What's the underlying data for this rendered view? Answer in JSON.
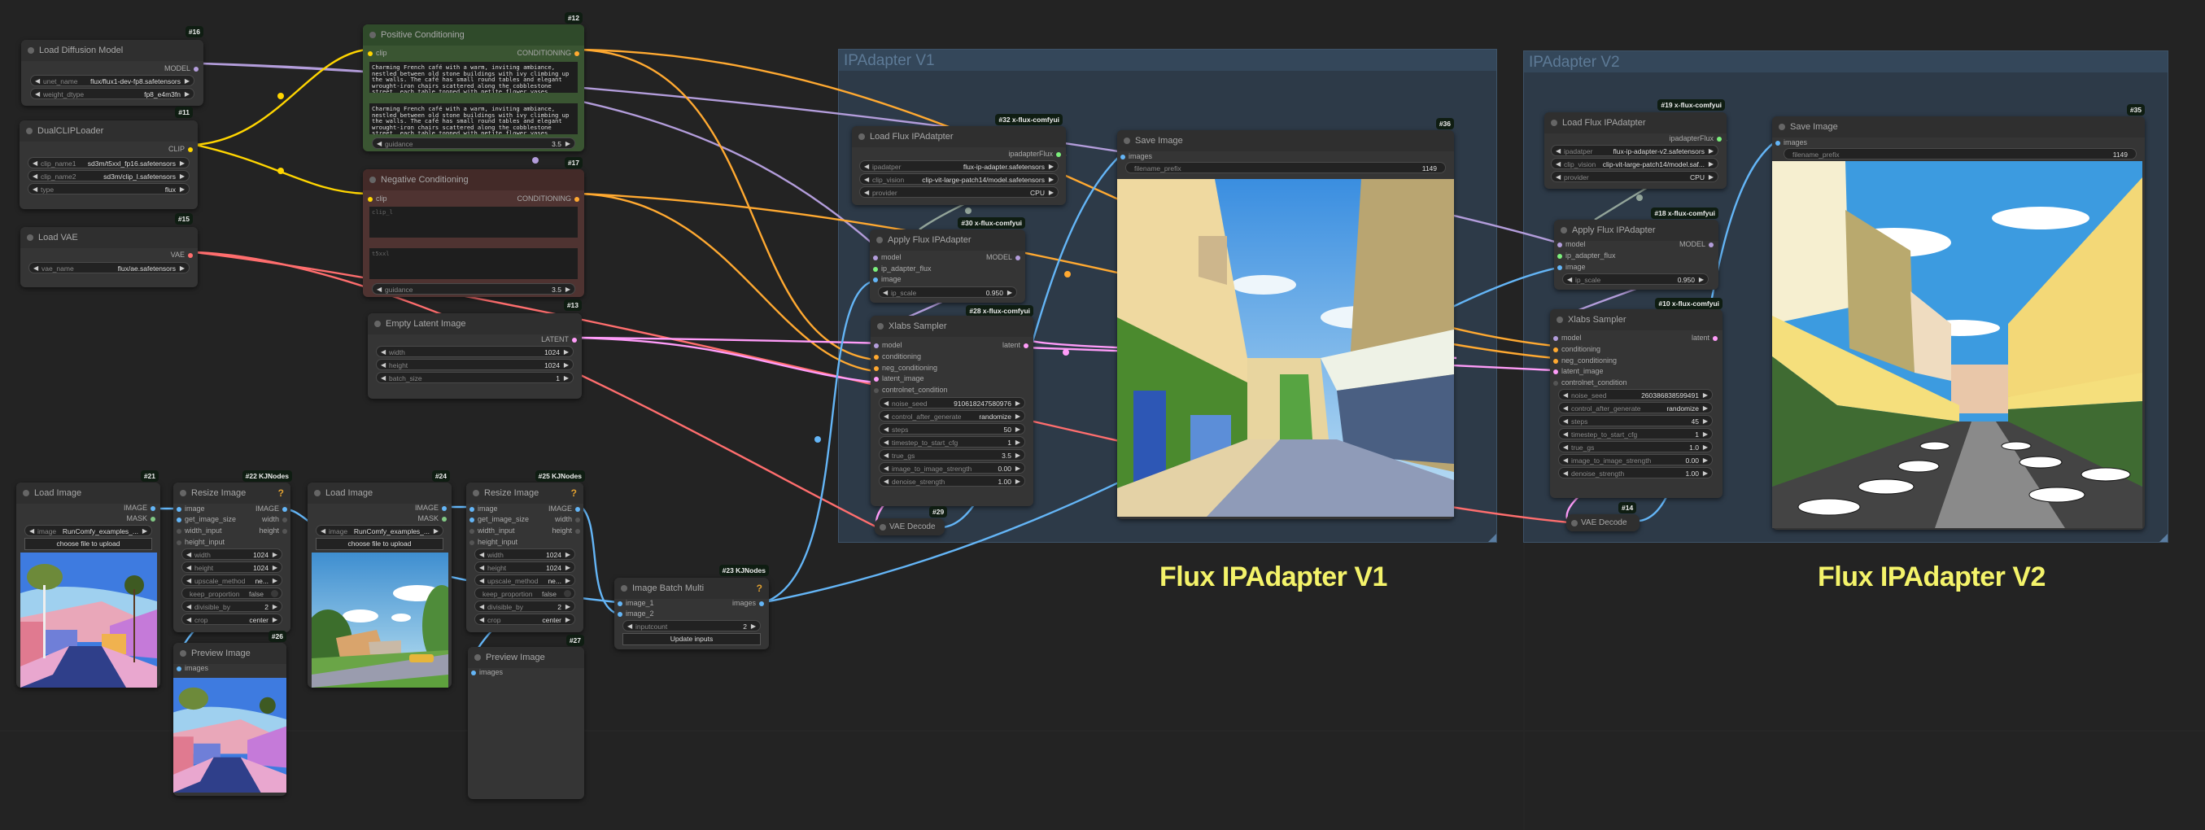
{
  "canvas": {
    "groups": [
      {
        "title": "IPAdapter V1"
      },
      {
        "title": "IPAdapter V2"
      }
    ],
    "labels": [
      "Flux IPAdapter V1",
      "Flux IPAdapter V2"
    ]
  },
  "nodes": {
    "n16": {
      "badge": "#16",
      "title": "Load Diffusion Model",
      "outputs": [
        "MODEL"
      ],
      "widgets": [
        {
          "label": "unet_name",
          "value": "flux/flux1-dev-fp8.safetensors"
        },
        {
          "label": "weight_dtype",
          "value": "fp8_e4m3fn"
        }
      ]
    },
    "n11": {
      "badge": "#11",
      "title": "DualCLIPLoader",
      "outputs": [
        "CLIP"
      ],
      "widgets": [
        {
          "label": "clip_name1",
          "value": "sd3m/t5xxl_fp16.safetensors"
        },
        {
          "label": "clip_name2",
          "value": "sd3m/clip_l.safetensors"
        },
        {
          "label": "type",
          "value": "flux"
        }
      ]
    },
    "n15": {
      "badge": "#15",
      "title": "Load VAE",
      "outputs": [
        "VAE"
      ],
      "widgets": [
        {
          "label": "vae_name",
          "value": "flux/ae.safetensors"
        }
      ]
    },
    "n12": {
      "badge": "#12",
      "title": "Positive Conditioning",
      "inputs": [
        "clip"
      ],
      "outputs": [
        "CONDITIONING"
      ],
      "clip_l": "Charming French café with a warm, inviting ambiance, nestled between old stone buildings with ivy climbing up the walls. The café has small round tables and elegant wrought-iron chairs scattered along the cobblestone street, each table topped with petite flower vases",
      "t5xxl": "Charming French café with a warm, inviting ambiance, nestled between old stone buildings with ivy climbing up the walls. The café has small round tables and elegant wrought-iron chairs scattered along the cobblestone street, each table topped with petite flower vases",
      "widgets": [
        {
          "label": "guidance",
          "value": "3.5"
        }
      ]
    },
    "n17": {
      "badge": "#17",
      "title": "Negative Conditioning",
      "inputs": [
        "clip"
      ],
      "outputs": [
        "CONDITIONING"
      ],
      "clip_l_placeholder": "clip_l",
      "t5xxl_placeholder": "t5xxl",
      "widgets": [
        {
          "label": "guidance",
          "value": "3.5"
        }
      ]
    },
    "n13": {
      "badge": "#13",
      "title": "Empty Latent Image",
      "outputs": [
        "LATENT"
      ],
      "widgets": [
        {
          "label": "width",
          "value": "1024"
        },
        {
          "label": "height",
          "value": "1024"
        },
        {
          "label": "batch_size",
          "value": "1"
        }
      ]
    },
    "n32": {
      "badge": "#32 x-flux-comfyui",
      "title": "Load Flux IPAdatpter",
      "outputs": [
        "ipadapterFlux"
      ],
      "widgets": [
        {
          "label": "ipadatper",
          "value": "flux-ip-adapter.safetensors"
        },
        {
          "label": "clip_vision",
          "value": "clip-vit-large-patch14/model.safetensors"
        },
        {
          "label": "provider",
          "value": "CPU"
        }
      ]
    },
    "n30": {
      "badge": "#30 x-flux-comfyui",
      "title": "Apply Flux IPAdapter",
      "inputs": [
        "model",
        "ip_adapter_flux",
        "image"
      ],
      "outputs": [
        "MODEL"
      ],
      "widgets": [
        {
          "label": "ip_scale",
          "value": "0.950"
        }
      ]
    },
    "n28": {
      "badge": "#28 x-flux-comfyui",
      "title": "Xlabs Sampler",
      "inputs": [
        "model",
        "conditioning",
        "neg_conditioning",
        "latent_image",
        "controlnet_condition"
      ],
      "outputs": [
        "latent"
      ],
      "widgets": [
        {
          "label": "noise_seed",
          "value": "910618247580976"
        },
        {
          "label": "control_after_generate",
          "value": "randomize"
        },
        {
          "label": "steps",
          "value": "50"
        },
        {
          "label": "timestep_to_start_cfg",
          "value": "1"
        },
        {
          "label": "true_gs",
          "value": "3.5"
        },
        {
          "label": "image_to_image_strength",
          "value": "0.00"
        },
        {
          "label": "denoise_strength",
          "value": "1.00"
        }
      ]
    },
    "n29": {
      "badge": "#29",
      "title": "VAE Decode"
    },
    "n36": {
      "badge": "#36",
      "title": "Save Image",
      "inputs": [
        "images"
      ],
      "widgets": [
        {
          "label": "filename_prefix",
          "value": "1149"
        }
      ],
      "image_alt": "Generated French café street (V1)"
    },
    "n19": {
      "badge": "#19 x-flux-comfyui",
      "title": "Load Flux IPAdatpter",
      "outputs": [
        "ipadapterFlux"
      ],
      "widgets": [
        {
          "label": "ipadatper",
          "value": "flux-ip-adapter-v2.safetensors"
        },
        {
          "label": "clip_vision",
          "value": "clip-vit-large-patch14/model.saf..."
        },
        {
          "label": "provider",
          "value": "CPU"
        }
      ]
    },
    "n18": {
      "badge": "#18 x-flux-comfyui",
      "title": "Apply Flux IPAdapter",
      "inputs": [
        "model",
        "ip_adapter_flux",
        "image"
      ],
      "outputs": [
        "MODEL"
      ],
      "widgets": [
        {
          "label": "ip_scale",
          "value": "0.950"
        }
      ]
    },
    "n10": {
      "badge": "#10 x-flux-comfyui",
      "title": "Xlabs Sampler",
      "inputs": [
        "model",
        "conditioning",
        "neg_conditioning",
        "latent_image",
        "controlnet_condition"
      ],
      "outputs": [
        "latent"
      ],
      "widgets": [
        {
          "label": "noise_seed",
          "value": "260386838599491"
        },
        {
          "label": "control_after_generate",
          "value": "randomize"
        },
        {
          "label": "steps",
          "value": "45"
        },
        {
          "label": "timestep_to_start_cfg",
          "value": "1"
        },
        {
          "label": "true_gs",
          "value": "1.0"
        },
        {
          "label": "image_to_image_strength",
          "value": "0.00"
        },
        {
          "label": "denoise_strength",
          "value": "1.00"
        }
      ]
    },
    "n14": {
      "badge": "#14",
      "title": "VAE Decode"
    },
    "n35": {
      "badge": "#35",
      "title": "Save Image",
      "inputs": [
        "images"
      ],
      "widgets": [
        {
          "label": "filename_prefix",
          "value": "1149"
        }
      ],
      "image_alt": "Generated French café street (V2)"
    },
    "n21": {
      "badge": "#21",
      "title": "Load Image",
      "outputs": [
        "IMAGE",
        "MASK"
      ],
      "widgets": [
        {
          "label": "image",
          "value": "RunComfy_examples_..."
        }
      ],
      "upload_label": "choose file to upload"
    },
    "n22": {
      "badge": "#22 KJNodes",
      "title": "Resize Image",
      "help": "?",
      "inputs": [
        "image",
        "get_image_size",
        "width_input",
        "height_input"
      ],
      "outputs": [
        "IMAGE",
        "width",
        "height"
      ],
      "widgets": [
        {
          "label": "width",
          "value": "1024"
        },
        {
          "label": "height",
          "value": "1024"
        },
        {
          "label": "upscale_method",
          "value": "ne..."
        },
        {
          "label": "keep_proportion",
          "value": "false"
        },
        {
          "label": "divisible_by",
          "value": "2"
        },
        {
          "label": "crop",
          "value": "center"
        }
      ]
    },
    "n26": {
      "badge": "#26",
      "title": "Preview Image",
      "inputs": [
        "images"
      ]
    },
    "n24": {
      "badge": "#24",
      "title": "Load Image",
      "outputs": [
        "IMAGE",
        "MASK"
      ],
      "widgets": [
        {
          "label": "image",
          "value": "RunComfy_examples_..."
        }
      ],
      "upload_label": "choose file to upload"
    },
    "n25": {
      "badge": "#25 KJNodes",
      "title": "Resize Image",
      "help": "?",
      "inputs": [
        "image",
        "get_image_size",
        "width_input",
        "height_input"
      ],
      "outputs": [
        "IMAGE",
        "width",
        "height"
      ],
      "widgets": [
        {
          "label": "width",
          "value": "1024"
        },
        {
          "label": "height",
          "value": "1024"
        },
        {
          "label": "upscale_method",
          "value": "ne..."
        },
        {
          "label": "keep_proportion",
          "value": "false"
        },
        {
          "label": "divisible_by",
          "value": "2"
        },
        {
          "label": "crop",
          "value": "center"
        }
      ]
    },
    "n27": {
      "badge": "#27",
      "title": "Preview Image",
      "inputs": [
        "images"
      ]
    },
    "n23": {
      "badge": "#23 KJNodes",
      "title": "Image Batch Multi",
      "help": "?",
      "inputs": [
        "image_1",
        "image_2"
      ],
      "outputs": [
        "images"
      ],
      "widgets": [
        {
          "label": "inputcount",
          "value": "2"
        }
      ],
      "button_label": "Update inputs"
    }
  },
  "colors": {
    "model": "#b39ddb",
    "clip": "#ffd500",
    "vae": "#ff6e6e",
    "conditioning": "#ffa931",
    "latent": "#ff9cf9",
    "image": "#64b5f6",
    "mask": "#81c784",
    "ipadapter": "#7cf07c",
    "label": "#f4f36a",
    "group": "#2d3a48"
  }
}
